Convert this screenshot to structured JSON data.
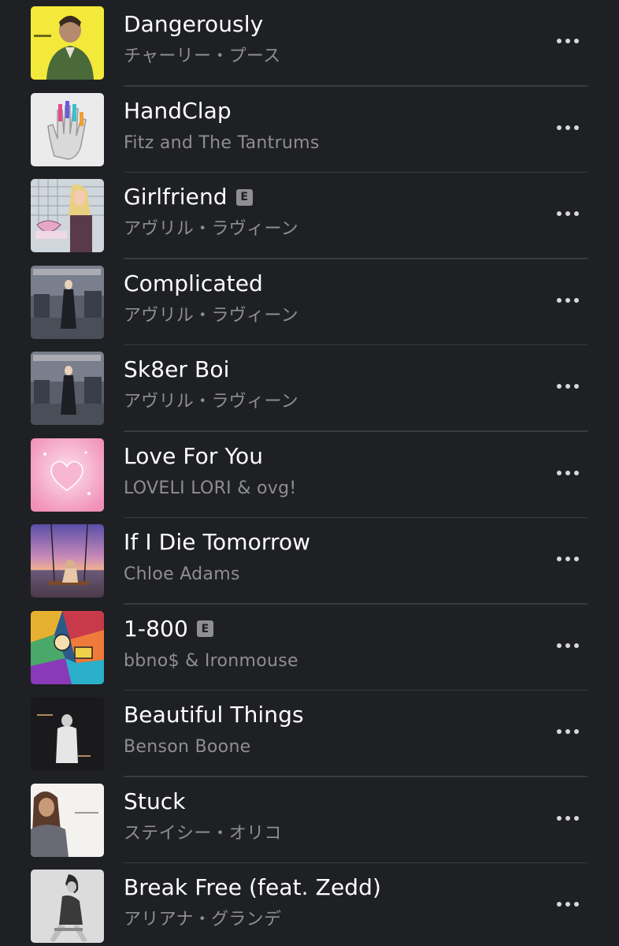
{
  "songs": [
    {
      "title": "Dangerously",
      "artist": "チャーリー・プース",
      "explicit": false,
      "art_icon": "album-art-dangerously"
    },
    {
      "title": "HandClap",
      "artist": "Fitz and The Tantrums",
      "explicit": false,
      "art_icon": "album-art-handclap"
    },
    {
      "title": "Girlfriend",
      "artist": "アヴリル・ラヴィーン",
      "explicit": true,
      "art_icon": "album-art-girlfriend"
    },
    {
      "title": "Complicated",
      "artist": "アヴリル・ラヴィーン",
      "explicit": false,
      "art_icon": "album-art-let-go"
    },
    {
      "title": "Sk8er Boi",
      "artist": "アヴリル・ラヴィーン",
      "explicit": false,
      "art_icon": "album-art-let-go"
    },
    {
      "title": "Love For You",
      "artist": "LOVELI LORI & ovg!",
      "explicit": false,
      "art_icon": "album-art-love-for-you"
    },
    {
      "title": "If I Die Tomorrow",
      "artist": "Chloe Adams",
      "explicit": false,
      "art_icon": "album-art-if-i-die-tomorrow"
    },
    {
      "title": "1-800",
      "artist": "bbno$ & Ironmouse",
      "explicit": true,
      "art_icon": "album-art-1-800"
    },
    {
      "title": "Beautiful Things",
      "artist": "Benson Boone",
      "explicit": false,
      "art_icon": "album-art-beautiful-things"
    },
    {
      "title": "Stuck",
      "artist": "ステイシー・オリコ",
      "explicit": false,
      "art_icon": "album-art-stacie-orrico"
    },
    {
      "title": "Break Free (feat. Zedd)",
      "artist": "アリアナ・グランデ",
      "explicit": false,
      "art_icon": "album-art-my-everything"
    }
  ],
  "explicit_badge": "E",
  "more_icon": "more-horizontal-icon",
  "colors": {
    "background": "#1f2023",
    "title": "#ffffff",
    "subtitle": "#8e8e93",
    "divider": "#3a3b3f",
    "more_dots": "#d8d8dc"
  }
}
